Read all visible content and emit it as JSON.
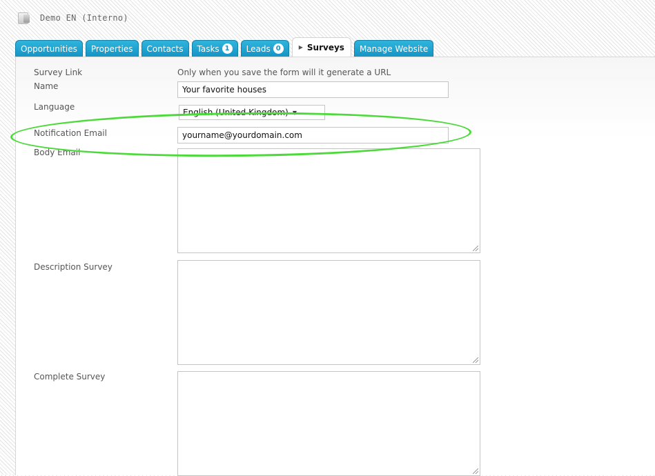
{
  "header": {
    "title": "Demo EN (Interno)",
    "icon": "app-logo-icon"
  },
  "tabs": [
    {
      "label": "Opportunities"
    },
    {
      "label": "Properties"
    },
    {
      "label": "Contacts"
    },
    {
      "label": "Tasks",
      "badge": "1"
    },
    {
      "label": "Leads",
      "badge": "0"
    },
    {
      "label": "Surveys",
      "active": true
    },
    {
      "label": "Manage Website"
    }
  ],
  "form": {
    "survey_link": {
      "label": "Survey Link",
      "value": "Only when you save the form will it generate a URL"
    },
    "name": {
      "label": "Name",
      "value": "Your favorite houses"
    },
    "language": {
      "label": "Language",
      "value": "English (United Kingdom)"
    },
    "notification_email": {
      "label": "Notification Email",
      "value": "yourname@yourdomain.com"
    },
    "body_email": {
      "label": "Body Email",
      "value": ""
    },
    "description_survey": {
      "label": "Description Survey",
      "value": ""
    },
    "complete_survey": {
      "label": "Complete Survey",
      "value": ""
    }
  },
  "colors": {
    "tab": "#1694c4",
    "highlight": "#4cd93a"
  }
}
